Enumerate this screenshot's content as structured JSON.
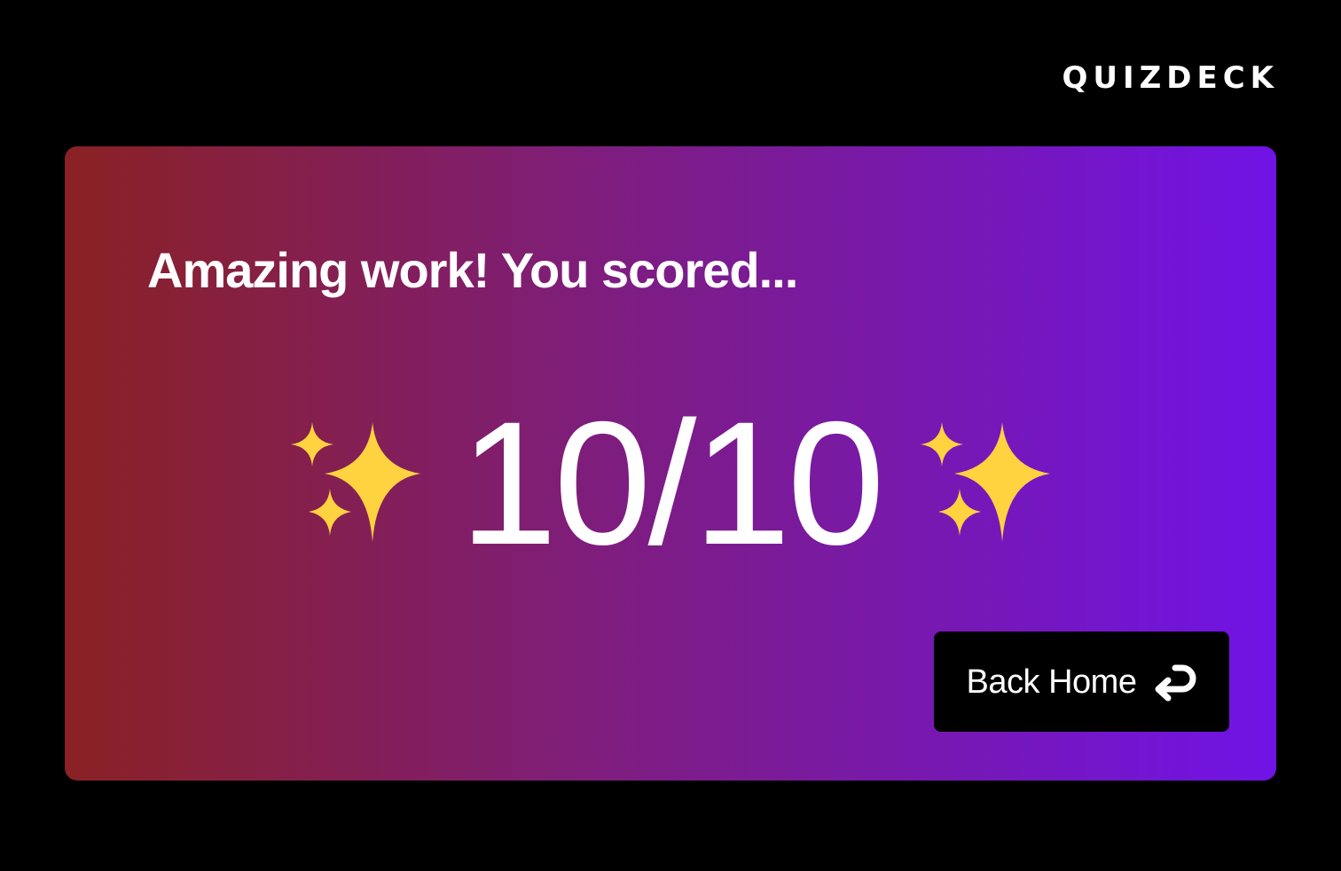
{
  "header": {
    "logo_text": "QUIZDECK"
  },
  "result_card": {
    "headline": "Amazing work! You scored...",
    "score": "10/10",
    "decoration_icon": "sparkles-icon",
    "gradient_colors": [
      "#8a2124",
      "#7e1d7f",
      "#7013e6"
    ]
  },
  "actions": {
    "back_home_label": "Back Home",
    "back_home_icon": "return-arrow-icon"
  },
  "colors": {
    "background": "#000000",
    "text": "#ffffff",
    "button_background": "#000000",
    "sparkle_yellow": "#ffd23f"
  }
}
